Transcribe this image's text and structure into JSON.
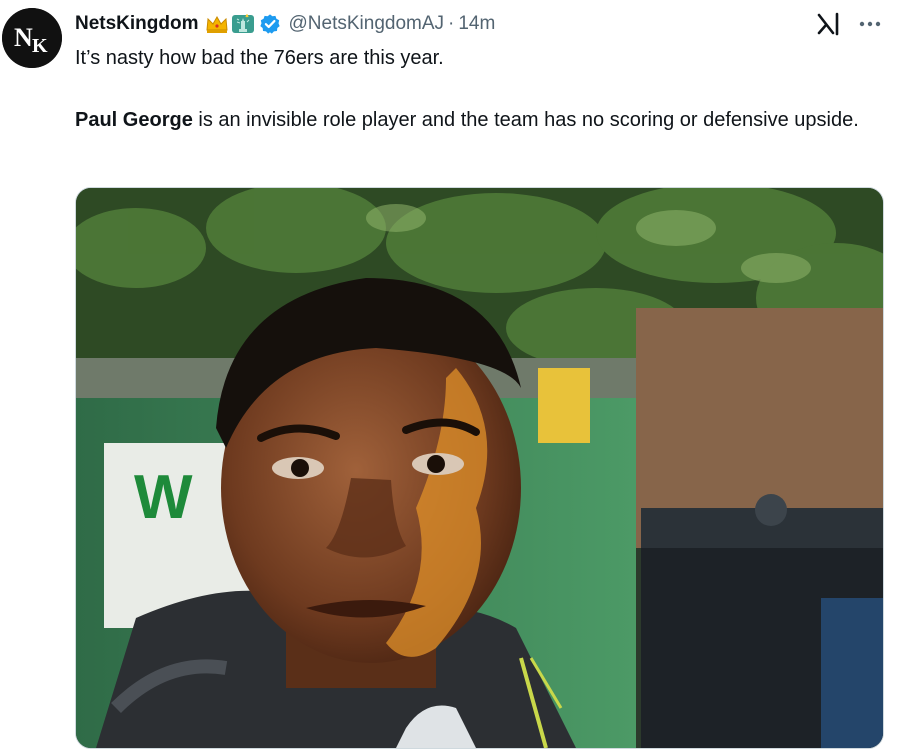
{
  "tweet": {
    "author": {
      "display_name": "NetsKingdom",
      "handle": "@NetsKingdomAJ",
      "avatar_initials": "NK",
      "badges": [
        "crown-emoji",
        "statue-of-liberty-emoji"
      ],
      "verified": true
    },
    "separator": "·",
    "timestamp": "14m",
    "text": {
      "line1": "It’s nasty how bad the 76ers are this year.",
      "mention_name": "Paul George",
      "line2_rest": " is an invisible role player and the team has no scoring or defensive upside."
    },
    "media": {
      "type": "video",
      "sign_letters": "W"
    }
  },
  "icons": {
    "grok": "grok-icon",
    "more": "more-options-icon",
    "verified": "verified-badge-icon"
  },
  "colors": {
    "verified_blue": "#1d9bf0",
    "secondary_text": "#536471",
    "primary_text": "#0f1419"
  }
}
